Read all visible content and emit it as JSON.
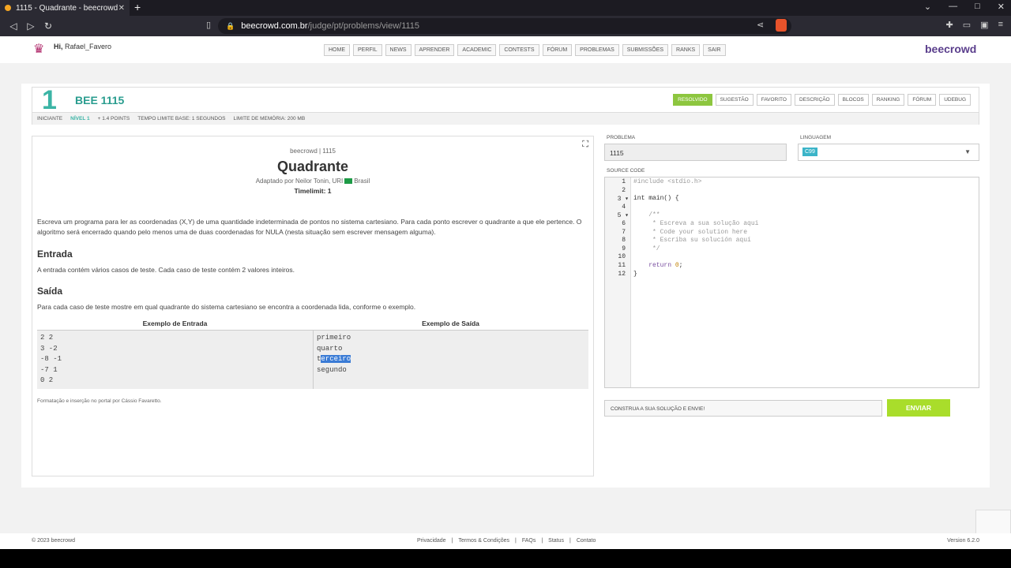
{
  "browser": {
    "tab_title": "1115 - Quadrante - beecrowd",
    "url_host": "beecrowd.com.br",
    "url_path": "/judge/pt/problems/view/1115"
  },
  "header": {
    "greeting": "Hi,",
    "user": "Rafael_Favero",
    "menu": [
      "HOME",
      "PERFIL",
      "NEWS",
      "APRENDER",
      "ACADEMIC",
      "CONTESTS",
      "FÓRUM",
      "PROBLEMAS",
      "SUBMISSÕES",
      "RANKS",
      "SAIR"
    ],
    "logo": "beecrowd"
  },
  "problem": {
    "title": "BEE 1115",
    "tabs": [
      "RESOLVIDO",
      "SUGESTÃO",
      "FAVORITO",
      "DESCRIÇÃO",
      "BLOCOS",
      "RANKING",
      "FÓRUM",
      "UDEBUG"
    ],
    "meta": {
      "category": "INICIANTE",
      "level": "NÍVEL 1",
      "points": "+ 1.4 POINTS",
      "time": "TEMPO LIMITE BASE: 1 SEGUNDOS",
      "memory": "LIMITE DE MEMÓRIA: 200 MB"
    }
  },
  "statement": {
    "source": "beecrowd | 1115",
    "name": "Quadrante",
    "adapted_prefix": "Adaptado por Neilor Tonin, URI",
    "adapted_country": "Brasil",
    "timelimit": "Timelimit: 1",
    "description": "Escreva um programa para ler as coordenadas (X,Y) de uma quantidade indeterminada de pontos no sistema cartesiano. Para cada ponto escrever o quadrante a que ele pertence. O algoritmo será encerrado quando pelo menos uma de duas coordenadas for NULA (nesta situação sem escrever mensagem alguma).",
    "input_title": "Entrada",
    "input_text": "A entrada contém vários casos de teste. Cada caso de teste contém 2 valores inteiros.",
    "output_title": "Saída",
    "output_text": "Para cada caso de teste mostre em qual quadrante do sistema cartesiano se encontra a coordenada lida, conforme o exemplo.",
    "example_input_header": "Exemplo de Entrada",
    "example_output_header": "Exemplo de Saída",
    "example_input": [
      "2 2",
      "3 -2",
      "-8 -1",
      "-7 1",
      "0 2"
    ],
    "example_output": [
      "primeiro",
      "quarto",
      "terceiro",
      "segundo"
    ],
    "credit": "Formatação e inserção no portal por Cássio Favaretto."
  },
  "editor": {
    "problem_label": "PROBLEMA",
    "problem_value": "1115",
    "language_label": "LINGUAGEM",
    "language_value": "C99",
    "source_label": "SOURCE CODE",
    "line_numbers": [
      "1",
      "2",
      "3",
      "4",
      "5",
      "6",
      "7",
      "8",
      "9",
      "10",
      "11",
      "12"
    ],
    "code": [
      "#include <stdio.h>",
      "",
      "int main() {",
      "",
      "    /**",
      "     * Escreva a sua solução aqui",
      "     * Code your solution here",
      "     * Escriba su solución aquí",
      "     */",
      "",
      "    return 0;",
      "}"
    ],
    "hint": "CONSTRUA A SUA SOLUÇÃO E ENVIE!",
    "submit": "ENVIAR"
  },
  "footer": {
    "copyright": "© 2023 beecrowd",
    "links": [
      "Privacidade",
      "Termos & Condições",
      "FAQs",
      "Status",
      "Contato"
    ],
    "version": "Version 6.2.0"
  },
  "colors": {
    "accent": "#3bb4a5",
    "resolved": "#8dc63f",
    "submit": "#a9dd2b",
    "logo": "#5a3e8c"
  }
}
